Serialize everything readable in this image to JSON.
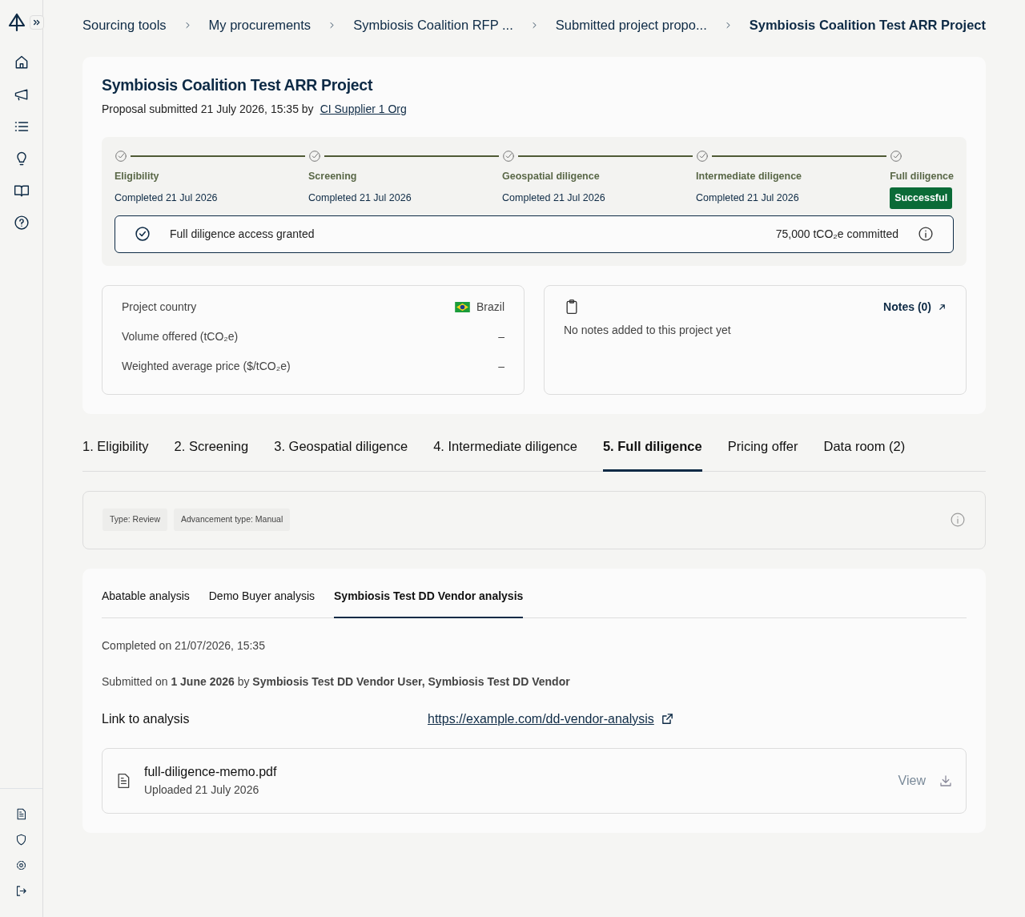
{
  "breadcrumbs": [
    {
      "label": "Sourcing tools",
      "current": false
    },
    {
      "label": "My procurements",
      "current": false
    },
    {
      "label": "Symbiosis Coalition RFP ...",
      "current": false
    },
    {
      "label": "Submitted project propo...",
      "current": false
    },
    {
      "label": "Symbiosis Coalition Test ARR Project",
      "current": true
    }
  ],
  "project": {
    "title": "Symbiosis Coalition Test ARR Project",
    "submitted": "Proposal submitted 21 July 2026, 15:35 by",
    "submitter": "CI Supplier 1 Org"
  },
  "stages": [
    {
      "name": "Eligibility",
      "kind": "date",
      "status": "Completed 21 Jul 2026"
    },
    {
      "name": "Screening",
      "kind": "date",
      "status": "Completed 21 Jul 2026"
    },
    {
      "name": "Geospatial diligence",
      "kind": "date",
      "status": "Completed 21 Jul 2026"
    },
    {
      "name": "Intermediate diligence",
      "kind": "date",
      "status": "Completed 21 Jul 2026"
    },
    {
      "name": "Full diligence",
      "kind": "badge",
      "status": "Successful"
    }
  ],
  "access": {
    "text": "Full diligence access granted",
    "committed": "75,000 tCO₂e committed"
  },
  "details": [
    {
      "label": "Project country",
      "value": "Brazil",
      "kind": "country"
    },
    {
      "label": "Volume offered (tCO₂e)",
      "value": "–",
      "kind": "plain"
    },
    {
      "label": "Weighted average price ($/tCO₂e)",
      "value": "–",
      "kind": "plain"
    }
  ],
  "notes": {
    "link": "Notes (0)",
    "empty": "No notes added to this project yet"
  },
  "tabs": [
    {
      "label": "1. Eligibility",
      "selected": false
    },
    {
      "label": "2. Screening",
      "selected": false
    },
    {
      "label": "3. Geospatial diligence",
      "selected": false
    },
    {
      "label": "4. Intermediate diligence",
      "selected": false
    },
    {
      "label": "5. Full diligence",
      "selected": true
    },
    {
      "label": "Pricing offer",
      "selected": false
    },
    {
      "label": "Data room (2)",
      "selected": false
    }
  ],
  "tags": [
    "Type: Review",
    "Advancement type: Manual"
  ],
  "analysis_tabs": [
    {
      "label": "Abatable analysis",
      "selected": false
    },
    {
      "label": "Demo Buyer analysis",
      "selected": false
    },
    {
      "label": "Symbiosis Test DD Vendor analysis",
      "selected": true
    }
  ],
  "analysis": {
    "completed": "Completed on 21/07/2026, 15:35",
    "submitted": "Submitted on **1 June 2026** by **Symbiosis Test DD Vendor User, Symbiosis Test DD Vendor**",
    "link_label": "Link to analysis",
    "link_url": "https://example.com/dd-vendor-analysis"
  },
  "file": {
    "name": "full-diligence-memo.pdf",
    "uploaded": "Uploaded 21 July 2026",
    "action": "View"
  }
}
